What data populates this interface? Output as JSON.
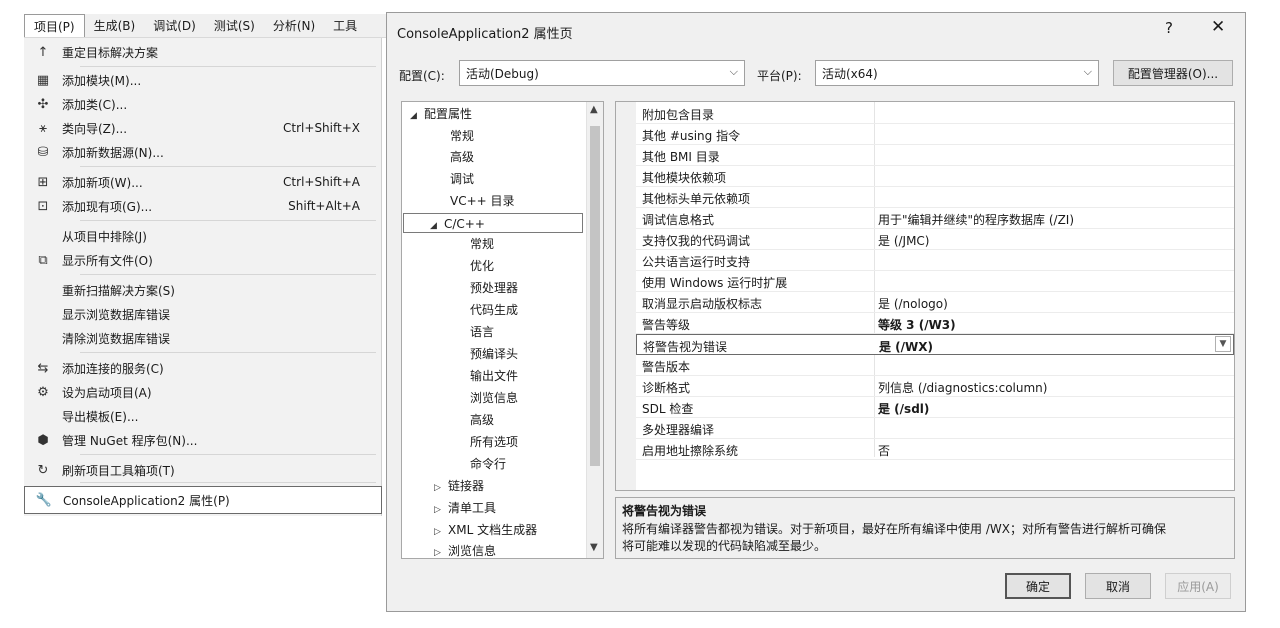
{
  "menubar": {
    "items": [
      "项目(P)",
      "生成(B)",
      "调试(D)",
      "测试(S)",
      "分析(N)",
      "工具"
    ]
  },
  "menu": {
    "items": [
      {
        "label": "重定目标解决方案",
        "shortcut": "",
        "icon": "arrow-up-icon"
      },
      {
        "label": "添加模块(M)...",
        "shortcut": "",
        "icon": "add-module-icon"
      },
      {
        "label": "添加类(C)...",
        "shortcut": "",
        "icon": "add-class-icon"
      },
      {
        "label": "类向导(Z)...",
        "shortcut": "Ctrl+Shift+X",
        "icon": "class-wizard-icon"
      },
      {
        "label": "添加新数据源(N)...",
        "shortcut": "",
        "icon": "add-datasource-icon"
      },
      {
        "label": "添加新项(W)...",
        "shortcut": "Ctrl+Shift+A",
        "icon": "add-new-item-icon"
      },
      {
        "label": "添加现有项(G)...",
        "shortcut": "Shift+Alt+A",
        "icon": "add-existing-item-icon"
      },
      {
        "label": "从项目中排除(J)",
        "shortcut": "",
        "icon": ""
      },
      {
        "label": "显示所有文件(O)",
        "shortcut": "",
        "icon": "show-all-files-icon"
      },
      {
        "label": "重新扫描解决方案(S)",
        "shortcut": "",
        "icon": ""
      },
      {
        "label": "显示浏览数据库错误",
        "shortcut": "",
        "icon": ""
      },
      {
        "label": "清除浏览数据库错误",
        "shortcut": "",
        "icon": ""
      },
      {
        "label": "添加连接的服务(C)",
        "shortcut": "",
        "icon": "connected-service-icon"
      },
      {
        "label": "设为启动项目(A)",
        "shortcut": "",
        "icon": "gear-icon"
      },
      {
        "label": "导出模板(E)...",
        "shortcut": "",
        "icon": ""
      },
      {
        "label": "管理 NuGet 程序包(N)...",
        "shortcut": "",
        "icon": "nuget-icon"
      },
      {
        "label": "刷新项目工具箱项(T)",
        "shortcut": "",
        "icon": "refresh-icon"
      },
      {
        "label": "ConsoleApplication2 属性(P)",
        "shortcut": "",
        "icon": "wrench-icon"
      }
    ]
  },
  "dialog": {
    "title": "ConsoleApplication2 属性页",
    "help": "?",
    "close": "✕",
    "config_label": "配置(C):",
    "config_value": "活动(Debug)",
    "platform_label": "平台(P):",
    "platform_value": "活动(x64)",
    "config_manager": "配置管理器(O)...",
    "tree": [
      {
        "label": "配置属性",
        "level": 0,
        "exp": "◢"
      },
      {
        "label": "常规",
        "level": 1,
        "exp": ""
      },
      {
        "label": "高级",
        "level": 1,
        "exp": ""
      },
      {
        "label": "调试",
        "level": 1,
        "exp": ""
      },
      {
        "label": "VC++ 目录",
        "level": 1,
        "exp": ""
      },
      {
        "label": "C/C++",
        "level": 1,
        "exp": "◢"
      },
      {
        "label": "常规",
        "level": 2,
        "exp": ""
      },
      {
        "label": "优化",
        "level": 2,
        "exp": ""
      },
      {
        "label": "预处理器",
        "level": 2,
        "exp": ""
      },
      {
        "label": "代码生成",
        "level": 2,
        "exp": ""
      },
      {
        "label": "语言",
        "level": 2,
        "exp": ""
      },
      {
        "label": "预编译头",
        "level": 2,
        "exp": ""
      },
      {
        "label": "输出文件",
        "level": 2,
        "exp": ""
      },
      {
        "label": "浏览信息",
        "level": 2,
        "exp": ""
      },
      {
        "label": "高级",
        "level": 2,
        "exp": ""
      },
      {
        "label": "所有选项",
        "level": 2,
        "exp": ""
      },
      {
        "label": "命令行",
        "level": 2,
        "exp": ""
      },
      {
        "label": "链接器",
        "level": 1,
        "exp": "▷"
      },
      {
        "label": "清单工具",
        "level": 1,
        "exp": "▷"
      },
      {
        "label": "XML 文档生成器",
        "level": 1,
        "exp": "▷"
      },
      {
        "label": "浏览信息",
        "level": 1,
        "exp": "▷"
      }
    ],
    "properties": [
      {
        "name": "附加包含目录",
        "value": "",
        "bold": false
      },
      {
        "name": "其他 #using 指令",
        "value": "",
        "bold": false
      },
      {
        "name": "其他 BMI 目录",
        "value": "",
        "bold": false
      },
      {
        "name": "其他模块依赖项",
        "value": "",
        "bold": false
      },
      {
        "name": "其他标头单元依赖项",
        "value": "",
        "bold": false
      },
      {
        "name": "调试信息格式",
        "value": "用于\"编辑并继续\"的程序数据库 (/ZI)",
        "bold": false
      },
      {
        "name": "支持仅我的代码调试",
        "value": "是 (/JMC)",
        "bold": false
      },
      {
        "name": "公共语言运行时支持",
        "value": "",
        "bold": false
      },
      {
        "name": "使用 Windows 运行时扩展",
        "value": "",
        "bold": false
      },
      {
        "name": "取消显示启动版权标志",
        "value": "是 (/nologo)",
        "bold": false
      },
      {
        "name": "警告等级",
        "value": "等级 3 (/W3)",
        "bold": true
      },
      {
        "name": "将警告视为错误",
        "value": "是 (/WX)",
        "bold": true
      },
      {
        "name": "警告版本",
        "value": "",
        "bold": false
      },
      {
        "name": "诊断格式",
        "value": "列信息 (/diagnostics:column)",
        "bold": false
      },
      {
        "name": "SDL 检查",
        "value": "是 (/sdl)",
        "bold": true
      },
      {
        "name": "多处理器编译",
        "value": "",
        "bold": false
      },
      {
        "name": "启用地址擦除系统",
        "value": "否",
        "bold": false
      }
    ],
    "description": {
      "title": "将警告视为错误",
      "line1": "将所有编译器警告都视为错误。对于新项目，最好在所有编译中使用 /WX；对所有警告进行解析可确保",
      "line2": "将可能难以发现的代码缺陷减至最少。"
    },
    "ok": "确定",
    "cancel": "取消",
    "apply": "应用(A)"
  }
}
